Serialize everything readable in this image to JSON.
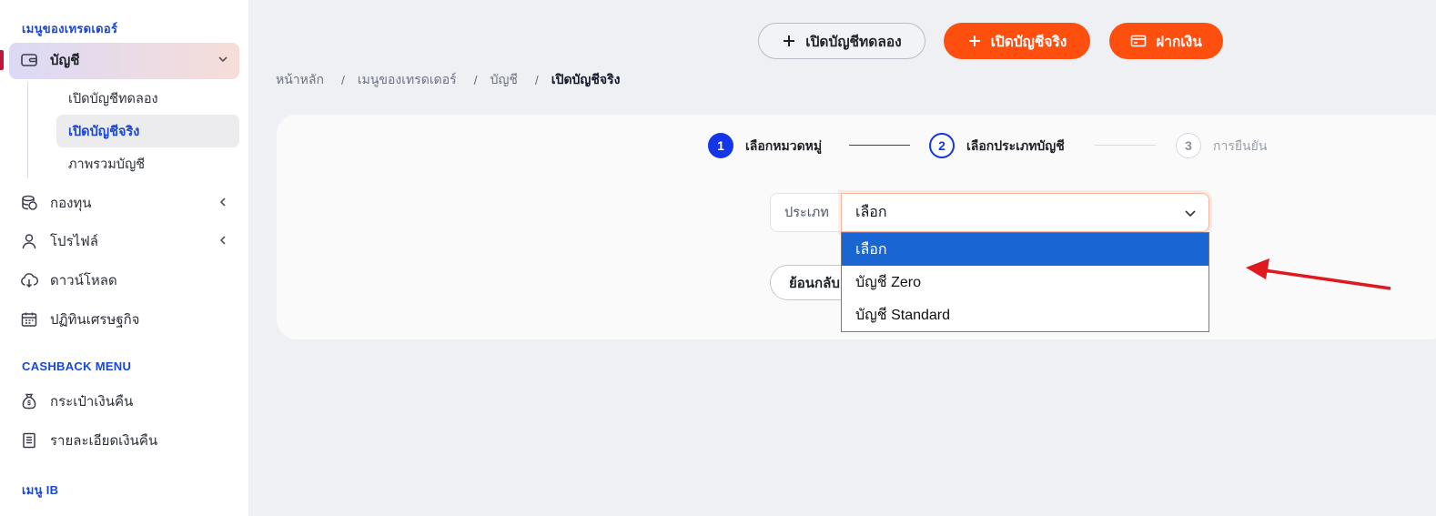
{
  "sidebar": {
    "section_trader": "เมนูของเทรดเดอร์",
    "items": [
      {
        "label": "บัญชี",
        "icon": "wallet-icon"
      },
      {
        "label": "กองทุน",
        "icon": "coins-icon"
      },
      {
        "label": "โปรไฟล์",
        "icon": "user-icon"
      },
      {
        "label": "ดาวน์โหลด",
        "icon": "cloud-download-icon"
      },
      {
        "label": "ปฏิทินเศรษฐกิจ",
        "icon": "calendar-icon"
      }
    ],
    "subitems": [
      "เปิดบัญชีทดลอง",
      "เปิดบัญชีจริง",
      "ภาพรวมบัญชี"
    ],
    "section_cashback": "CASHBACK MENU",
    "cashback_items": [
      {
        "label": "กระเป๋าเงินคืน",
        "icon": "money-bag-icon"
      },
      {
        "label": "รายละเอียดเงินคืน",
        "icon": "receipt-icon"
      }
    ],
    "section_ib": "เมนู IB"
  },
  "header": {
    "demo_button": "เปิดบัญชีทดลอง",
    "real_button": "เปิดบัญชีจริง",
    "deposit_button": "ฝากเงิน"
  },
  "breadcrumb": [
    "หน้าหลัก",
    "เมนูของเทรดเดอร์",
    "บัญชี",
    "เปิดบัญชีจริง"
  ],
  "stepper": [
    {
      "num": "1",
      "label": "เลือกหมวดหมู่",
      "state": "done"
    },
    {
      "num": "2",
      "label": "เลือกประเภทบัญชี",
      "state": "current"
    },
    {
      "num": "3",
      "label": "การยืนยัน",
      "state": "pending"
    }
  ],
  "form": {
    "type_label": "ประเภท",
    "selected": "เลือก",
    "options": [
      "เลือก",
      "บัญชี Zero",
      "บัญชี Standard"
    ],
    "back_button": "ย้อนกลับ"
  },
  "colors": {
    "brand_blue": "#1a47d6",
    "accent_orange": "#ff4f0f",
    "highlight_option": "#1966d2",
    "arrow_red": "#e0191e"
  }
}
